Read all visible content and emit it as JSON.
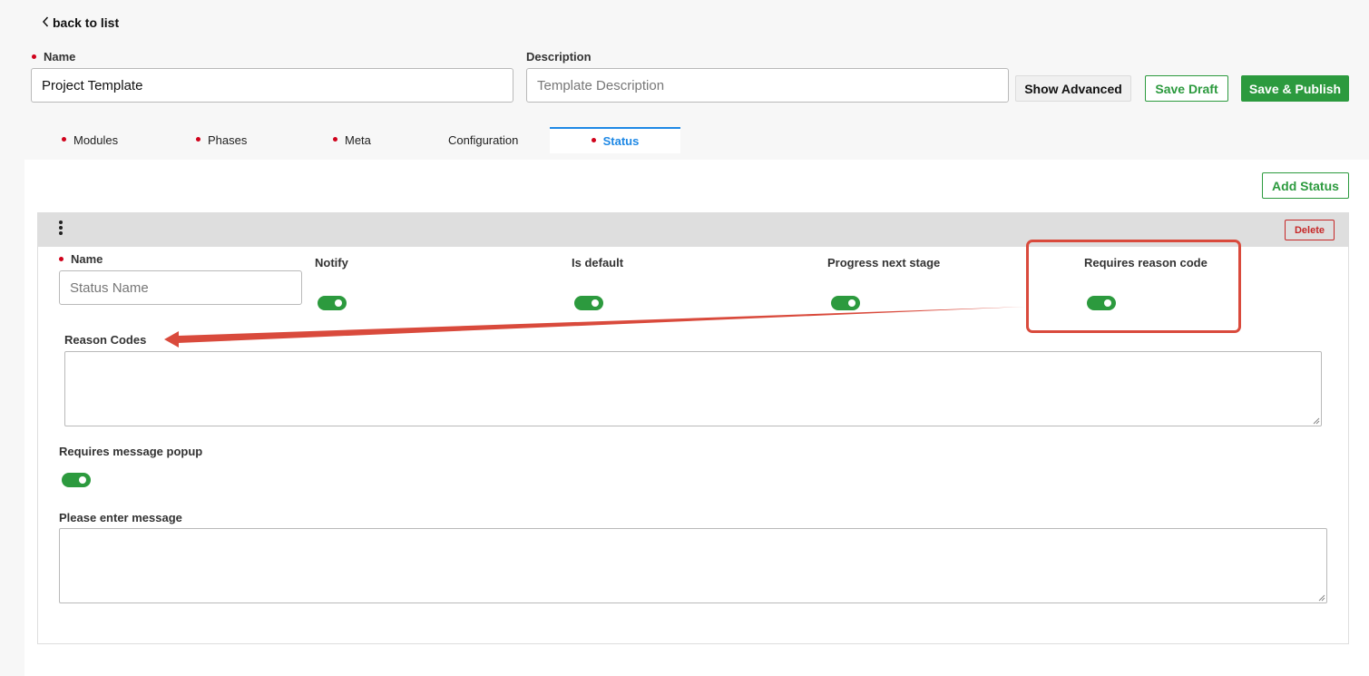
{
  "nav": {
    "back_label": "back to list",
    "back_icon": "chevron-left-icon"
  },
  "form": {
    "name_label": "Name",
    "name_value": "Project Template",
    "description_label": "Description",
    "description_placeholder": "Template Description"
  },
  "actions": {
    "show_advanced": "Show Advanced",
    "save_draft": "Save Draft",
    "save_publish": "Save & Publish"
  },
  "tabs": [
    {
      "label": "Modules",
      "required": true
    },
    {
      "label": "Phases",
      "required": true
    },
    {
      "label": "Meta",
      "required": true
    },
    {
      "label": "Configuration",
      "required": false
    },
    {
      "label": "Status",
      "required": true,
      "active": true
    }
  ],
  "status_panel": {
    "add_status": "Add Status",
    "card": {
      "menu_icon": "kebab-menu-icon",
      "delete_label": "Delete",
      "name_label": "Name",
      "name_placeholder": "Status Name",
      "notify_label": "Notify",
      "notify_on": true,
      "is_default_label": "Is default",
      "is_default_on": true,
      "progress_label": "Progress next stage",
      "progress_on": true,
      "reason_code_label": "Requires reason code",
      "reason_code_on": true,
      "reason_codes_label": "Reason Codes",
      "reason_codes_value": "",
      "message_popup_label": "Requires message popup",
      "message_popup_on": true,
      "message_label": "Please enter message",
      "message_value": ""
    }
  },
  "colors": {
    "primary_green": "#2c9a3e",
    "active_tab_blue": "#1e88e5",
    "required_red": "#d0021b",
    "annotation_red": "#d94a3c"
  }
}
